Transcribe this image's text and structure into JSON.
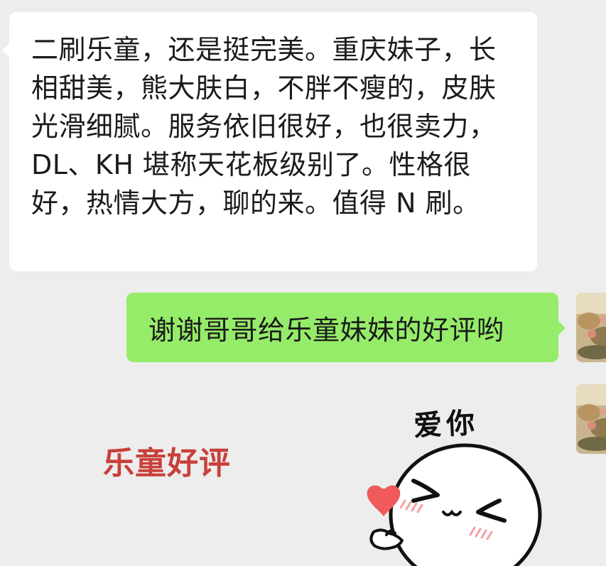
{
  "chat": {
    "messages": [
      {
        "direction": "incoming",
        "text": "二刷乐童，还是挺完美。重庆妹子，长相甜美，熊大肤白，不胖不瘦的，皮肤光滑细腻。服务依旧很好，也很卖力，DL、KH 堪称天花板级别了。性格很好，热情大方，聊的来。值得 N 刷。"
      },
      {
        "direction": "outgoing",
        "text": "谢谢哥哥给乐童妹妹的好评哟"
      },
      {
        "direction": "outgoing",
        "type": "sticker",
        "sticker_text": "爱你"
      }
    ],
    "watermark": "乐童好评"
  },
  "colors": {
    "background": "#ededed",
    "incoming_bubble": "#ffffff",
    "outgoing_bubble": "#95ec69",
    "watermark": "#c9403a",
    "heart": "#f05a5a",
    "blush": "#f4a0a5"
  },
  "icons": {
    "sticker": "love-you-sticker",
    "avatar": "user-avatar-photo"
  }
}
